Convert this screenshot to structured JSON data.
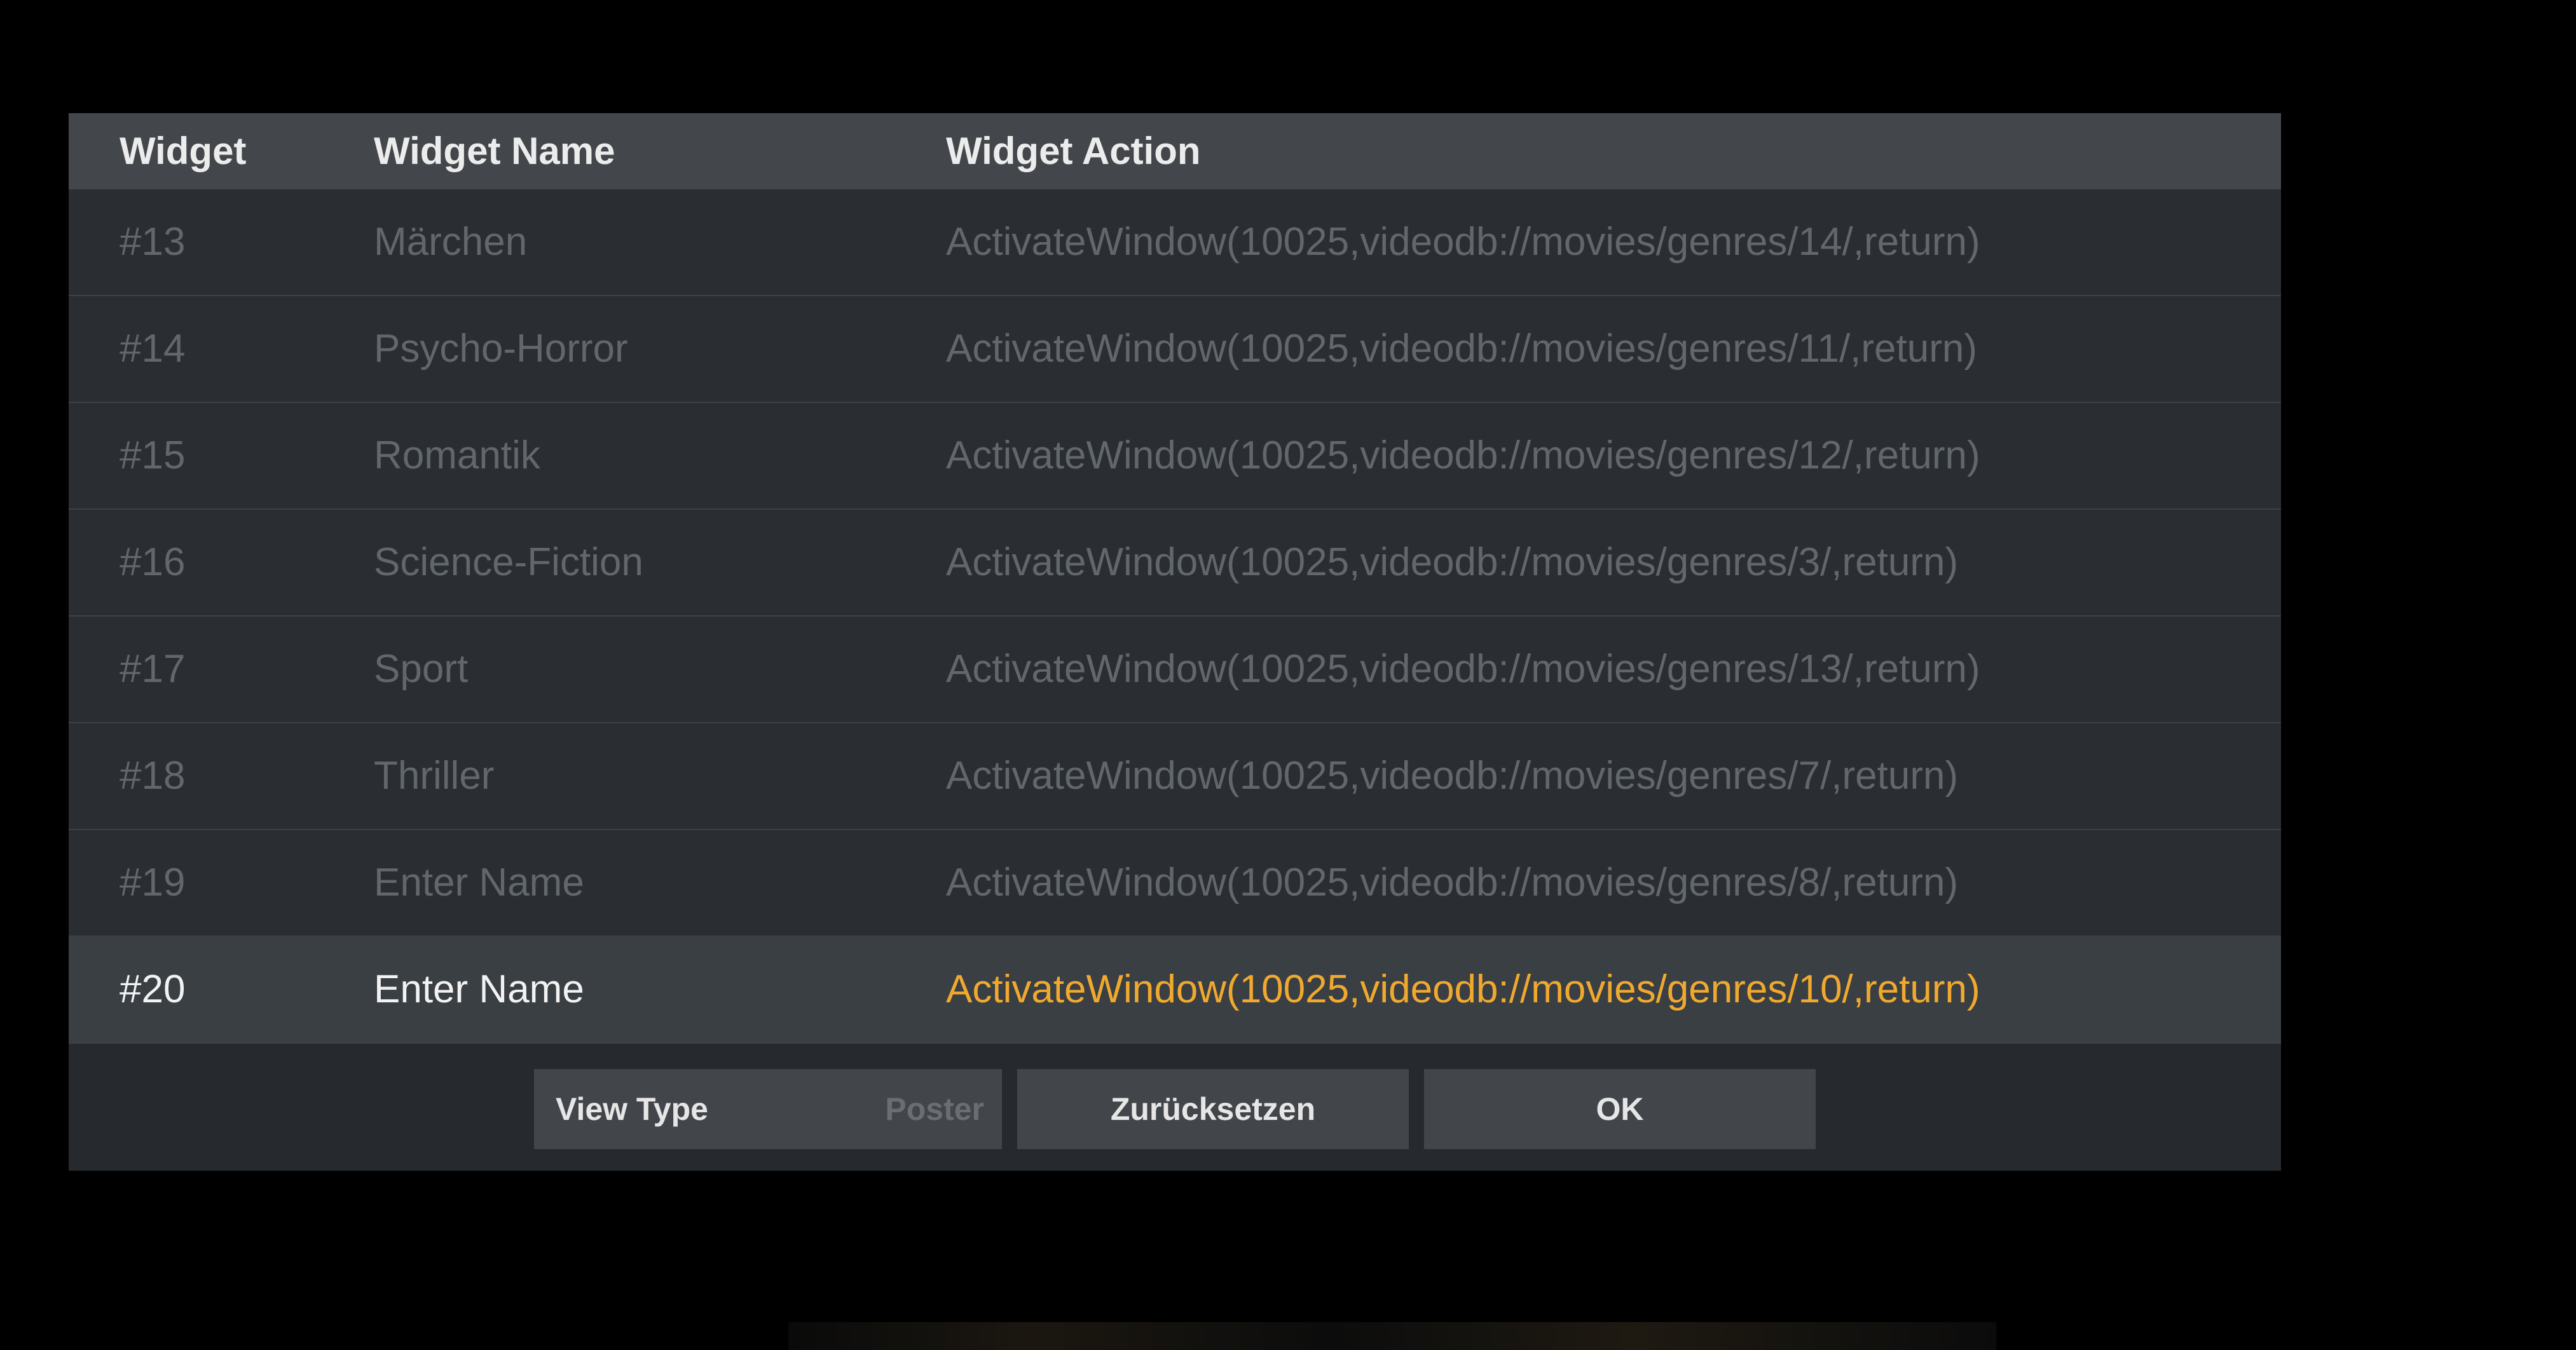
{
  "table": {
    "headers": [
      "Widget",
      "Widget Name",
      "Widget Action"
    ],
    "rows": [
      {
        "widget": "#13",
        "name": "Märchen",
        "action": "ActivateWindow(10025,videodb://movies/genres/14/,return)"
      },
      {
        "widget": "#14",
        "name": "Psycho-Horror",
        "action": "ActivateWindow(10025,videodb://movies/genres/11/,return)"
      },
      {
        "widget": "#15",
        "name": "Romantik",
        "action": "ActivateWindow(10025,videodb://movies/genres/12/,return)"
      },
      {
        "widget": "#16",
        "name": "Science-Fiction",
        "action": "ActivateWindow(10025,videodb://movies/genres/3/,return)"
      },
      {
        "widget": "#17",
        "name": "Sport",
        "action": "ActivateWindow(10025,videodb://movies/genres/13/,return)"
      },
      {
        "widget": "#18",
        "name": "Thriller",
        "action": "ActivateWindow(10025,videodb://movies/genres/7/,return)"
      },
      {
        "widget": "#19",
        "name": "Enter Name",
        "action": "ActivateWindow(10025,videodb://movies/genres/8/,return)"
      },
      {
        "widget": "#20",
        "name": "Enter Name",
        "action": "ActivateWindow(10025,videodb://movies/genres/10/,return)"
      }
    ],
    "selected_row": "#20"
  },
  "buttons": {
    "view_type_label": "View Type",
    "view_type_value": "Poster",
    "reset_label": "Zurücksetzen",
    "ok_label": "OK"
  },
  "colors": {
    "accent": "#f0a92e",
    "header_bg": "#43474b",
    "dialog_bg": "#262a2e",
    "selected_row_bg": "#3a3f44"
  }
}
